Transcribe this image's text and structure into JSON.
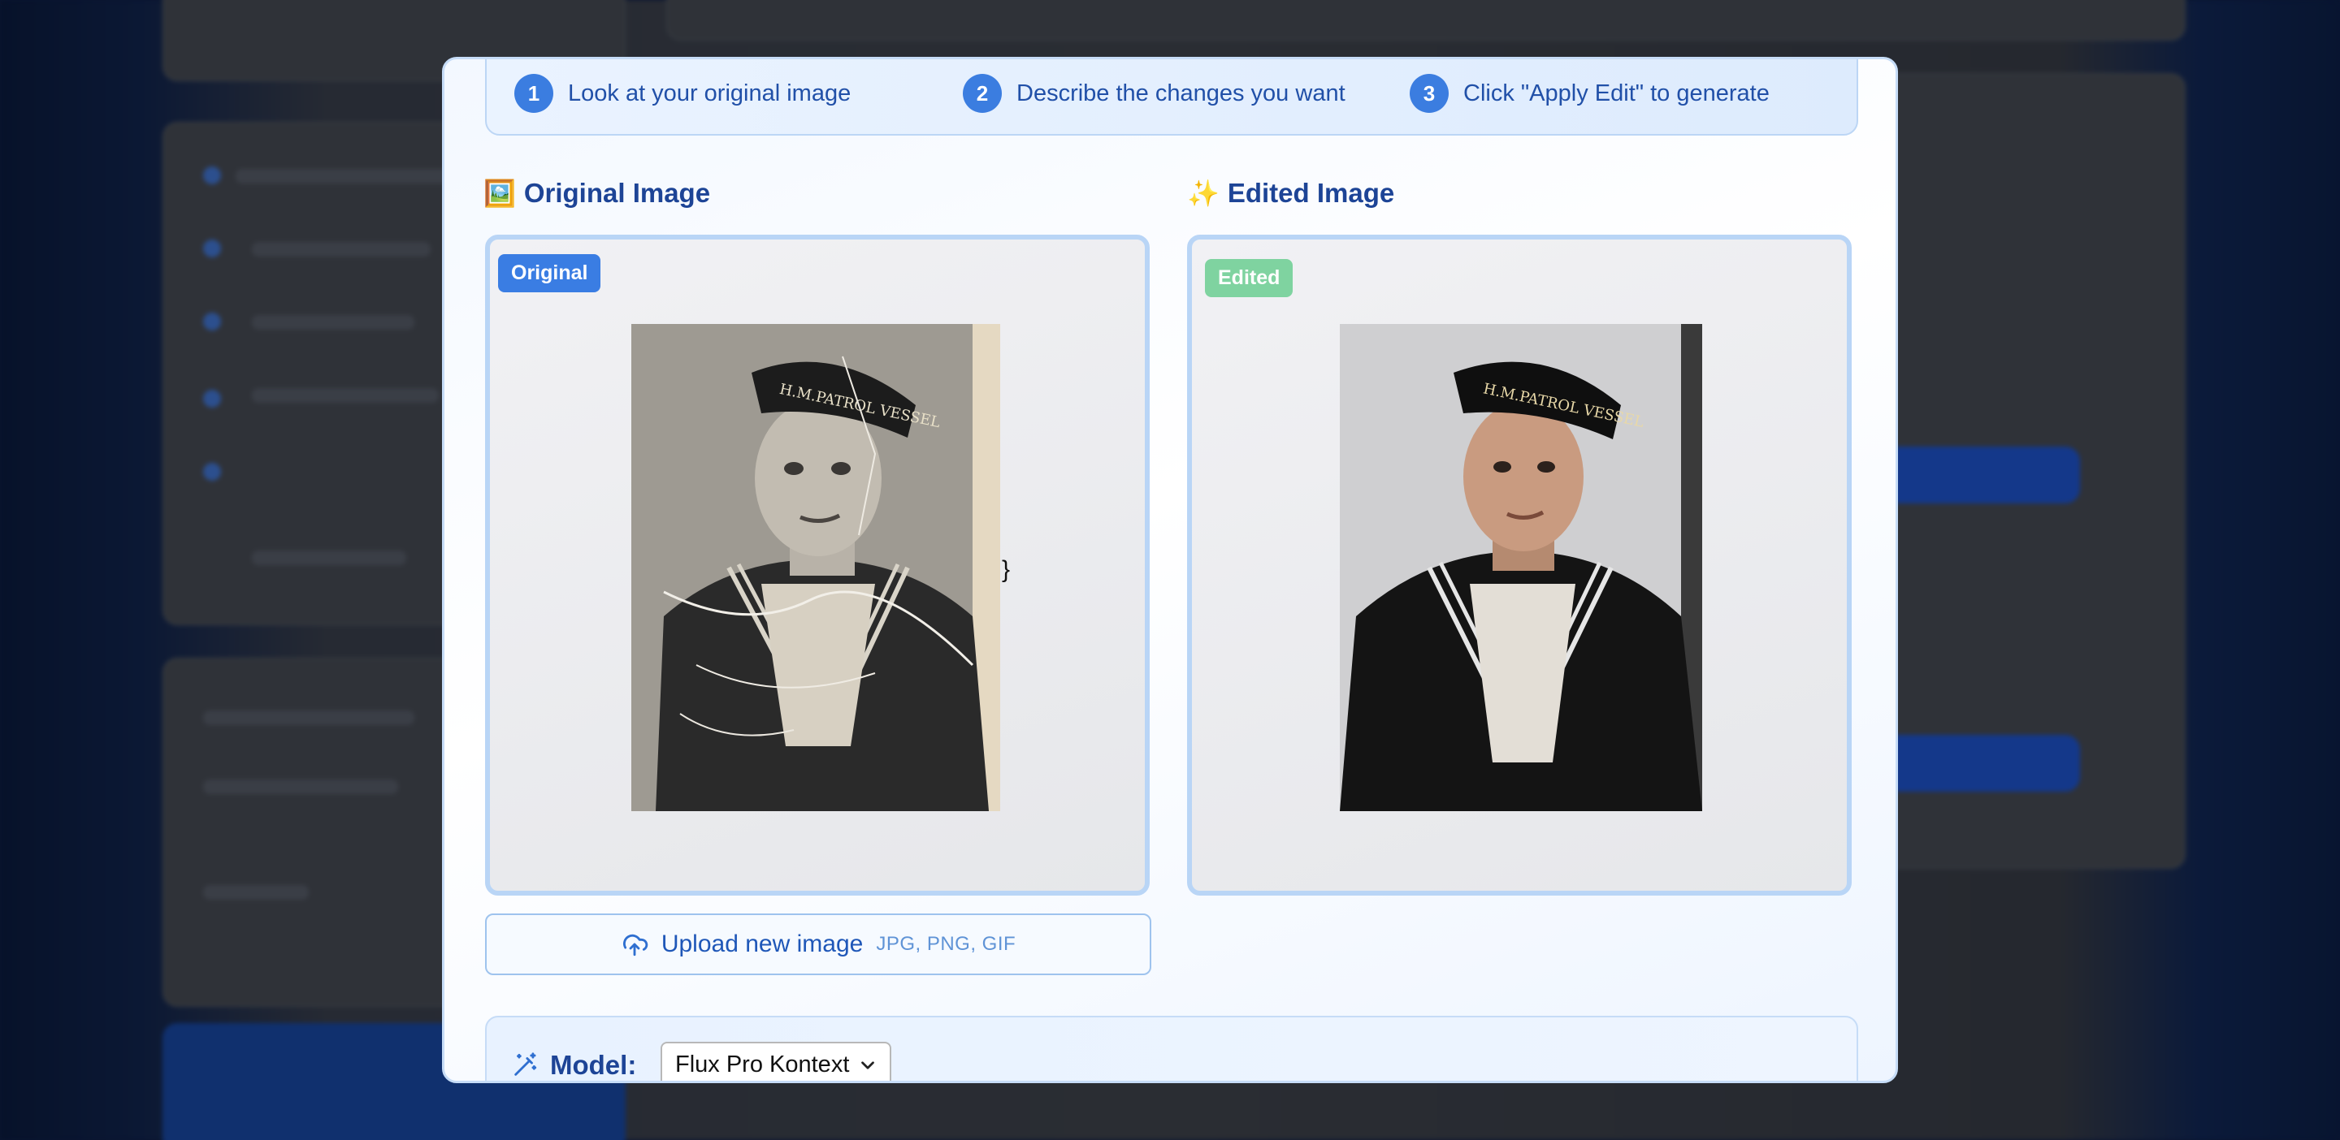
{
  "steps": [
    {
      "num": "1",
      "text": "Look at your original image"
    },
    {
      "num": "2",
      "text": "Describe the changes you want"
    },
    {
      "num": "3",
      "text": "Click \"Apply Edit\" to generate"
    }
  ],
  "original": {
    "icon": "🖼️",
    "title": "Original Image",
    "badge": "Original",
    "stray_text": "}"
  },
  "edited": {
    "icon": "✨",
    "title": "Edited Image",
    "badge": "Edited"
  },
  "upload": {
    "label": "Upload new image",
    "formats": "JPG, PNG, GIF",
    "icon": "cloud-upload-icon"
  },
  "model": {
    "label": "Model:",
    "selected": "Flux Pro Kontext",
    "icon": "magic-wand-icon"
  },
  "colors": {
    "accent": "#3b7de0",
    "title": "#1d4496",
    "edited_badge": "#7fd3a0",
    "panel_border": "#b9d5f6"
  }
}
